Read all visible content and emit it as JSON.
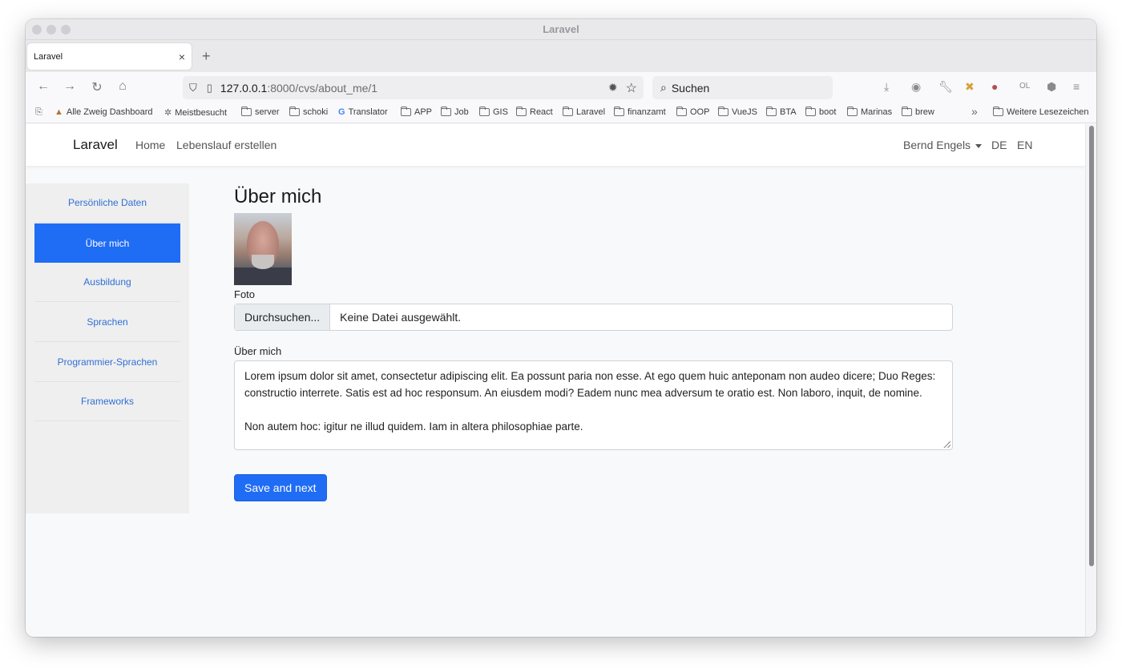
{
  "window": {
    "title": "Laravel"
  },
  "tab": {
    "label": "Laravel",
    "close": "×",
    "new_tab": "+"
  },
  "urlbar": {
    "host": "127.0.0.1",
    "path": ":8000/cvs/about_me/1"
  },
  "search": {
    "placeholder": "Suchen"
  },
  "toolbar_icons": {
    "ol": "OL"
  },
  "bookmarks": {
    "items": [
      {
        "label": "Alle Zweig Dashboard",
        "type": "site"
      },
      {
        "label": "Meistbesucht",
        "type": "gear"
      },
      {
        "label": "server",
        "type": "folder"
      },
      {
        "label": "schoki",
        "type": "folder"
      },
      {
        "label": "Translator",
        "type": "google"
      },
      {
        "label": "APP",
        "type": "folder"
      },
      {
        "label": "Job",
        "type": "folder"
      },
      {
        "label": "GIS",
        "type": "folder"
      },
      {
        "label": "React",
        "type": "folder"
      },
      {
        "label": "Laravel",
        "type": "folder"
      },
      {
        "label": "finanzamt",
        "type": "folder"
      },
      {
        "label": "OOP",
        "type": "folder"
      },
      {
        "label": "VueJS",
        "type": "folder"
      },
      {
        "label": "BTA",
        "type": "folder"
      },
      {
        "label": "boot",
        "type": "folder"
      },
      {
        "label": "Marinas",
        "type": "folder"
      },
      {
        "label": "brew",
        "type": "folder"
      }
    ],
    "more": "»",
    "other": "Weitere Lesezeichen"
  },
  "appnav": {
    "brand": "Laravel",
    "links": [
      "Home",
      "Lebenslauf erstellen"
    ],
    "user": "Bernd Engels",
    "lang_de": "DE",
    "lang_en": "EN"
  },
  "sidebar": {
    "items": [
      {
        "label": "Persönliche Daten",
        "active": false
      },
      {
        "label": "Über mich",
        "active": true
      },
      {
        "label": "Ausbildung",
        "active": false
      },
      {
        "label": "Sprachen",
        "active": false
      },
      {
        "label": "Programmier-Sprachen",
        "active": false
      },
      {
        "label": "Frameworks",
        "active": false
      }
    ]
  },
  "main": {
    "heading": "Über mich",
    "photo_label": "Foto",
    "file_button": "Durchsuchen...",
    "file_status": "Keine Datei ausgewählt.",
    "about_label": "Über mich",
    "about_p1": "Lorem ipsum dolor sit amet, consectetur adipiscing elit. Ea possunt paria non esse. At ego quem huic anteponam non audeo dicere; Duo Reges: constructio interrete. Satis est ad hoc responsum. An eiusdem modi? Eadem nunc mea adversum te oratio est. Non laboro, inquit, de nomine.",
    "about_p2": "Non autem hoc: igitur ne illud quidem. Iam in altera philosophiae parte.",
    "save_button": "Save and next"
  },
  "colors": {
    "primary": "#1f6cf5",
    "link": "#2f6fd6"
  }
}
